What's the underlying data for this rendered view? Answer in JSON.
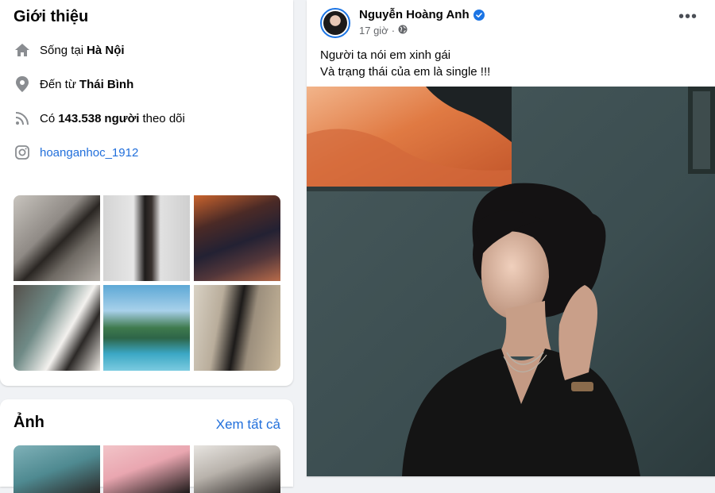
{
  "intro": {
    "title": "Giới thiệu",
    "lives_prefix": "Sống tại",
    "lives_city": "Hà Nội",
    "from_prefix": "Đến từ",
    "from_city": "Thái Bình",
    "followers_prefix": "Có",
    "followers_count": "143.538",
    "followers_suffix_bold": "người",
    "followers_suffix": "theo dõi",
    "instagram_handle": "hoanganhoc_1912"
  },
  "photos_section": {
    "title": "Ảnh",
    "see_all": "Xem tất cả"
  },
  "post": {
    "author": "Nguyễn Hoàng Anh",
    "time": "17 giờ",
    "privacy_icon": "globe-icon",
    "more_icon": "more-options-icon",
    "caption_line1": "Người ta nói em xinh gái",
    "caption_line2": "Và trạng thái của em là single !!!"
  },
  "colors": {
    "link": "#216fdb",
    "verified": "#1b74e4",
    "background": "#f0f2f5"
  }
}
